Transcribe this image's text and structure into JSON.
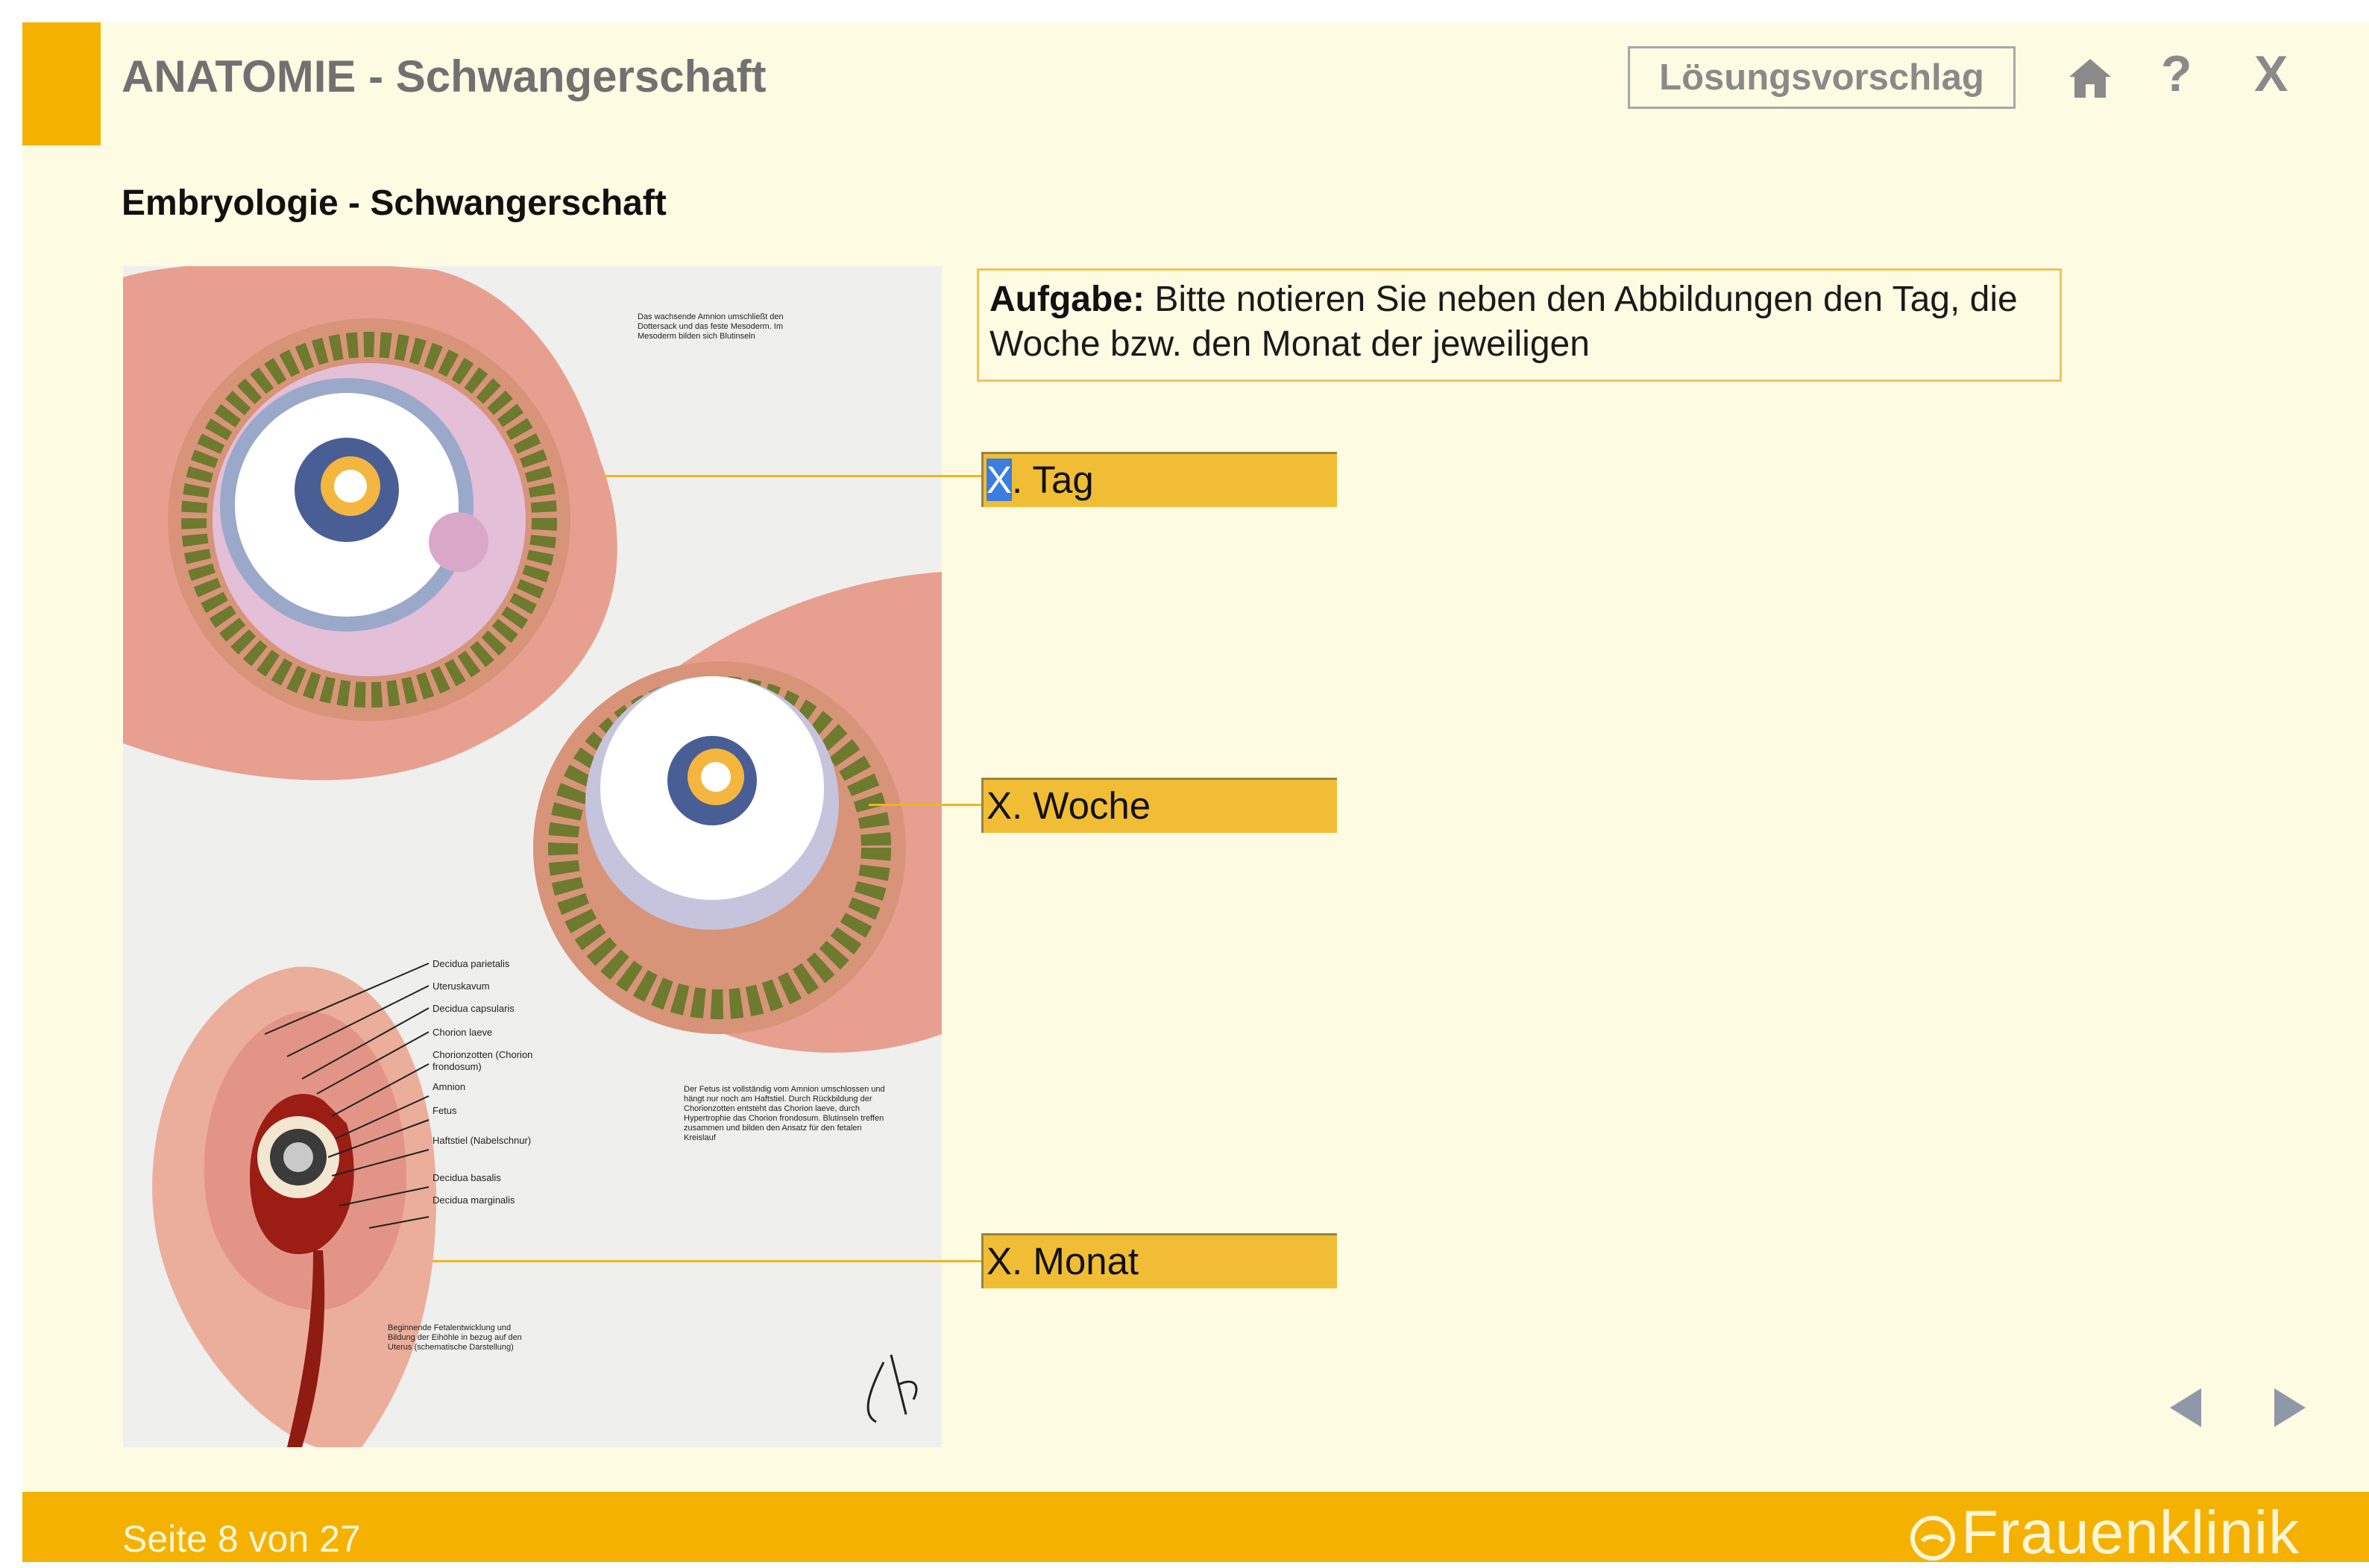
{
  "header": {
    "title": "ANATOMIE - Schwangerschaft",
    "solution_button": "Lösungsvorschlag",
    "help_label": "?",
    "close_label": "X",
    "home_icon": "home-icon"
  },
  "content": {
    "subtitle": "Embryologie - Schwangerschaft",
    "task": {
      "label": "Aufgabe:",
      "text": " Bitte notieren Sie neben den Abbildungen den Tag, die Woche bzw. den Monat der jeweiligen"
    },
    "answers": [
      {
        "selected": "X",
        "rest": ". Tag"
      },
      {
        "value": "X. Woche"
      },
      {
        "value": "X. Monat"
      }
    ],
    "illustration": {
      "caption_top": "Das wachsende Amnion umschließt den Dottersack und das feste Mesoderm. Im Mesoderm bilden sich Blutinseln",
      "labels": [
        "Decidua parietalis",
        "Uteruskavum",
        "Decidua capsularis",
        "Chorion laeve",
        "Chorionzotten (Chorion frondosum)",
        "Amnion",
        "Fetus",
        "Haftstiel (Nabelschnur)",
        "Decidua basalis",
        "Decidua marginalis"
      ],
      "caption_mid": "Der Fetus ist vollständig vom Amnion umschlossen und hängt nur noch am Haftstiel. Durch Rückbildung der Chorionzotten entsteht das Chorion laeve, durch Hypertrophie das Chorion frondosum. Blutinseln treffen zusammen und bilden den Ansatz für den fetalen Kreislauf",
      "caption_bottom": "Beginnende Fetalentwicklung und Bildung der Eihöhle in bezug auf den Uterus (schematische Darstellung)"
    }
  },
  "navigation": {
    "prev_icon": "arrow-left-icon",
    "next_icon": "arrow-right-icon"
  },
  "footer": {
    "page_info": "Seite 8 von 27",
    "brand": "Frauenklinik"
  },
  "colors": {
    "accent": "#f5b100",
    "page_bg": "#fefbe3",
    "answer_bg": "#f0bd35",
    "text_gray": "#717171"
  }
}
